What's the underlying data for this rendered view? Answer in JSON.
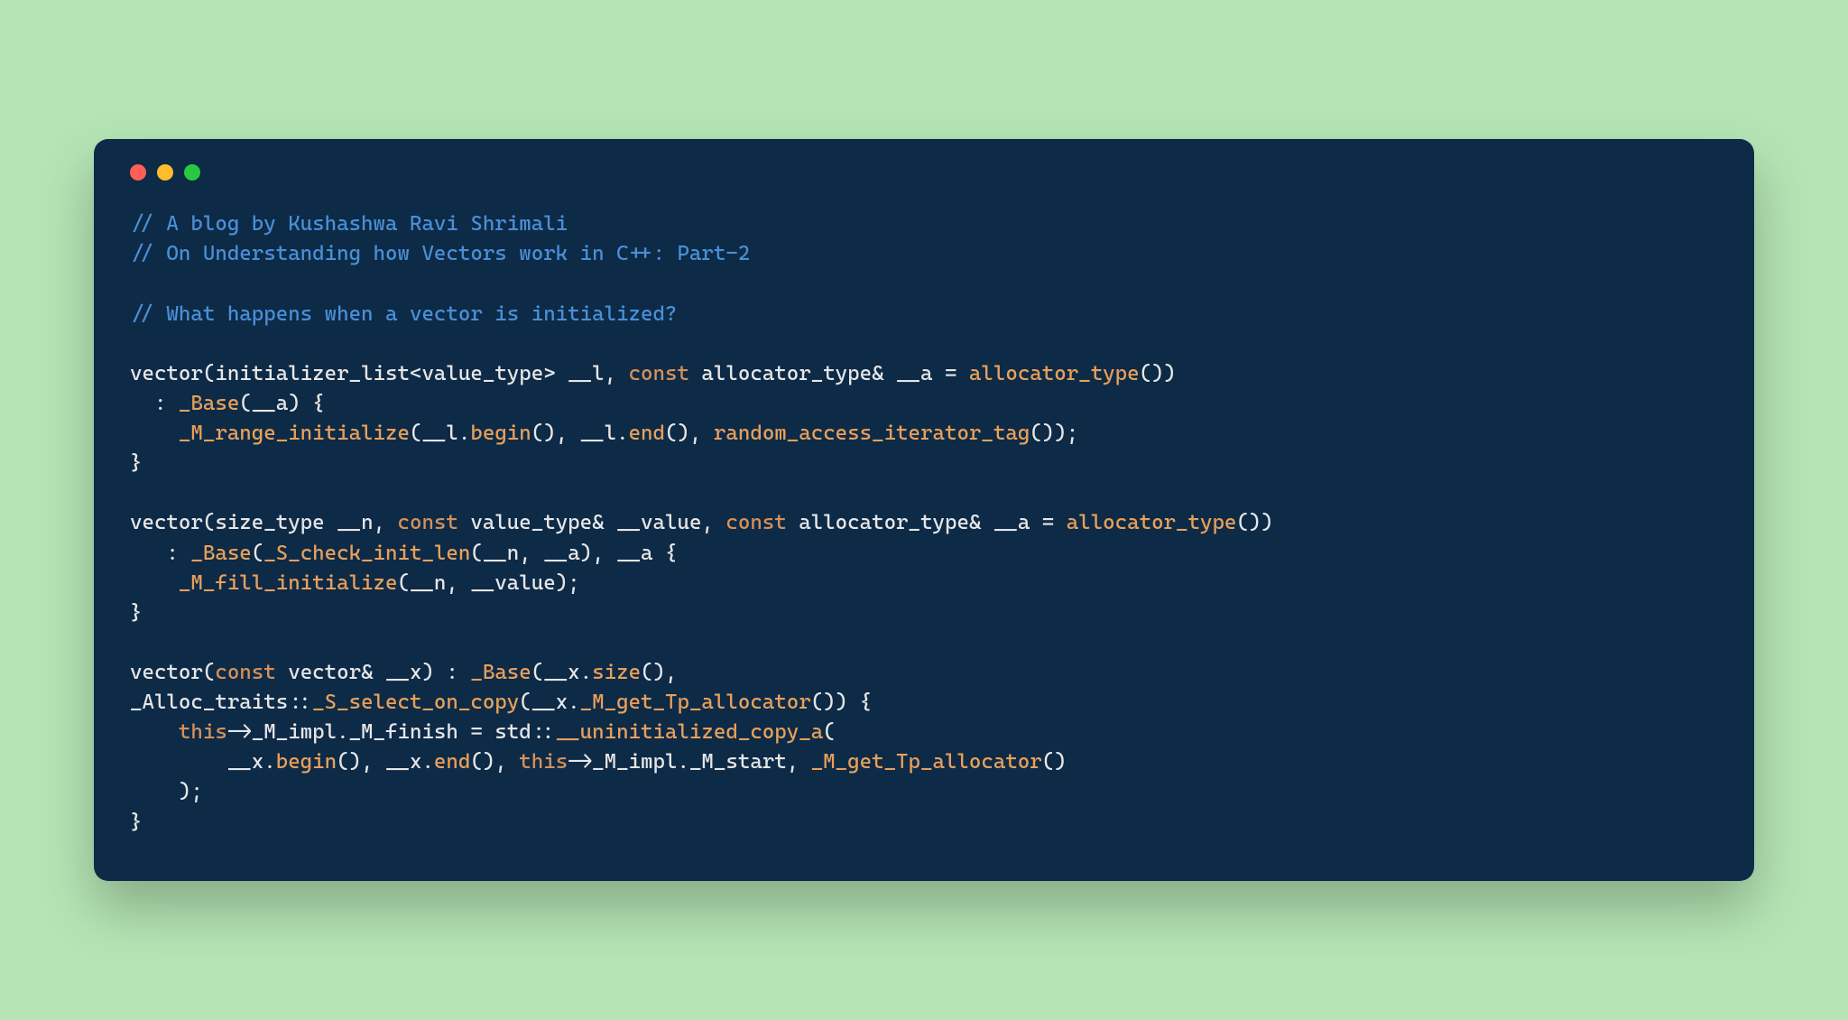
{
  "colors": {
    "bg": "#b5e5b5",
    "window": "#0d2a47",
    "dot_red": "#ff5f56",
    "dot_yellow": "#ffbd2e",
    "dot_green": "#27c93f",
    "comment": "#4a8fd6",
    "keyword": "#d6915a",
    "default": "#e6e6e6",
    "call": "#e8a05a"
  },
  "code": {
    "tokens": [
      [
        {
          "t": "// A blog by Kushashwa Ravi Shrimali",
          "c": "c-comment"
        }
      ],
      [
        {
          "t": "// On Understanding how Vectors work in C++: Part-2",
          "c": "c-comment"
        }
      ],
      [],
      [
        {
          "t": "// What happens when a vector is initialized?",
          "c": "c-comment"
        }
      ],
      [],
      [
        {
          "t": "vector",
          "c": "c-fn"
        },
        {
          "t": "(",
          "c": "c-op"
        },
        {
          "t": "initializer_list",
          "c": "c-ident"
        },
        {
          "t": "<",
          "c": "c-angle"
        },
        {
          "t": "value_type",
          "c": "c-ident"
        },
        {
          "t": ">",
          "c": "c-angle"
        },
        {
          "t": " __l, ",
          "c": "c-ident"
        },
        {
          "t": "const",
          "c": "c-keyword"
        },
        {
          "t": " allocator_type& __a = ",
          "c": "c-ident"
        },
        {
          "t": "allocator_type",
          "c": "c-call"
        },
        {
          "t": "())",
          "c": "c-op"
        }
      ],
      [
        {
          "t": "  : ",
          "c": "c-op"
        },
        {
          "t": "_Base",
          "c": "c-call"
        },
        {
          "t": "(__a) {",
          "c": "c-op"
        }
      ],
      [
        {
          "t": "    ",
          "c": "c-op"
        },
        {
          "t": "_M_range_initialize",
          "c": "c-call"
        },
        {
          "t": "(__l.",
          "c": "c-op"
        },
        {
          "t": "begin",
          "c": "c-call"
        },
        {
          "t": "(), __l.",
          "c": "c-op"
        },
        {
          "t": "end",
          "c": "c-call"
        },
        {
          "t": "(), ",
          "c": "c-op"
        },
        {
          "t": "random_access_iterator_tag",
          "c": "c-call"
        },
        {
          "t": "());",
          "c": "c-op"
        }
      ],
      [
        {
          "t": "}",
          "c": "c-op"
        }
      ],
      [],
      [
        {
          "t": "vector",
          "c": "c-fn"
        },
        {
          "t": "(",
          "c": "c-op"
        },
        {
          "t": "size_type __n, ",
          "c": "c-ident"
        },
        {
          "t": "const",
          "c": "c-keyword"
        },
        {
          "t": " value_type& __value, ",
          "c": "c-ident"
        },
        {
          "t": "const",
          "c": "c-keyword"
        },
        {
          "t": " allocator_type& __a = ",
          "c": "c-ident"
        },
        {
          "t": "allocator_type",
          "c": "c-call"
        },
        {
          "t": "())",
          "c": "c-op"
        }
      ],
      [
        {
          "t": "   : ",
          "c": "c-op"
        },
        {
          "t": "_Base",
          "c": "c-call"
        },
        {
          "t": "(",
          "c": "c-op"
        },
        {
          "t": "_S_check_init_len",
          "c": "c-call"
        },
        {
          "t": "(__n, __a), __a {",
          "c": "c-op"
        }
      ],
      [
        {
          "t": "    ",
          "c": "c-op"
        },
        {
          "t": "_M_fill_initialize",
          "c": "c-call"
        },
        {
          "t": "(__n, __value);",
          "c": "c-op"
        }
      ],
      [
        {
          "t": "}",
          "c": "c-op"
        }
      ],
      [],
      [
        {
          "t": "vector",
          "c": "c-fn"
        },
        {
          "t": "(",
          "c": "c-op"
        },
        {
          "t": "const",
          "c": "c-keyword"
        },
        {
          "t": " vector& __x) : ",
          "c": "c-ident"
        },
        {
          "t": "_Base",
          "c": "c-call"
        },
        {
          "t": "(__x.",
          "c": "c-op"
        },
        {
          "t": "size",
          "c": "c-call"
        },
        {
          "t": "(),",
          "c": "c-op"
        }
      ],
      [
        {
          "t": "_Alloc_traits::",
          "c": "c-ident"
        },
        {
          "t": "_S_select_on_copy",
          "c": "c-call"
        },
        {
          "t": "(__x.",
          "c": "c-op"
        },
        {
          "t": "_M_get_Tp_allocator",
          "c": "c-call"
        },
        {
          "t": "()) {",
          "c": "c-op"
        }
      ],
      [
        {
          "t": "    ",
          "c": "c-op"
        },
        {
          "t": "this",
          "c": "c-keyword"
        },
        {
          "t": "->",
          "c": "c-op"
        },
        {
          "t": "_M_impl._M_finish = std::",
          "c": "c-ident"
        },
        {
          "t": "__uninitialized_copy_a",
          "c": "c-call"
        },
        {
          "t": "(",
          "c": "c-op"
        }
      ],
      [
        {
          "t": "        __x.",
          "c": "c-op"
        },
        {
          "t": "begin",
          "c": "c-call"
        },
        {
          "t": "(), __x.",
          "c": "c-op"
        },
        {
          "t": "end",
          "c": "c-call"
        },
        {
          "t": "(), ",
          "c": "c-op"
        },
        {
          "t": "this",
          "c": "c-keyword"
        },
        {
          "t": "->",
          "c": "c-op"
        },
        {
          "t": "_M_impl._M_start, ",
          "c": "c-ident"
        },
        {
          "t": "_M_get_Tp_allocator",
          "c": "c-call"
        },
        {
          "t": "()",
          "c": "c-op"
        }
      ],
      [
        {
          "t": "    );",
          "c": "c-op"
        }
      ],
      [
        {
          "t": "}",
          "c": "c-op"
        }
      ]
    ]
  }
}
